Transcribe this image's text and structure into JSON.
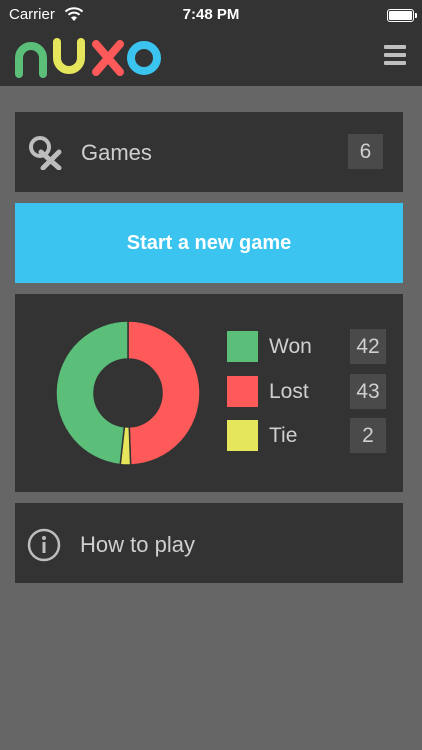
{
  "status_bar": {
    "carrier": "Carrier",
    "time": "7:48 PM"
  },
  "header": {
    "logo": {
      "letters": [
        "n",
        "u",
        "x",
        "o"
      ],
      "colors": [
        "#5bbf7a",
        "#e6e65c",
        "#ff5a5a",
        "#3bc4ef"
      ]
    }
  },
  "games": {
    "label": "Games",
    "count": "6"
  },
  "start_button": {
    "label": "Start a new game"
  },
  "stats": {
    "legend": [
      {
        "label": "Won",
        "value": "42",
        "color": "#5bbf7a"
      },
      {
        "label": "Lost",
        "value": "43",
        "color": "#ff5a5a"
      },
      {
        "label": "Tie",
        "value": "2",
        "color": "#e6e65c"
      }
    ]
  },
  "chart_data": {
    "type": "pie",
    "categories": [
      "Won",
      "Lost",
      "Tie"
    ],
    "values": [
      42,
      43,
      2
    ],
    "colors": [
      "#5bbf7a",
      "#ff5a5a",
      "#e6e65c"
    ]
  },
  "how_to_play": {
    "label": "How to play"
  }
}
